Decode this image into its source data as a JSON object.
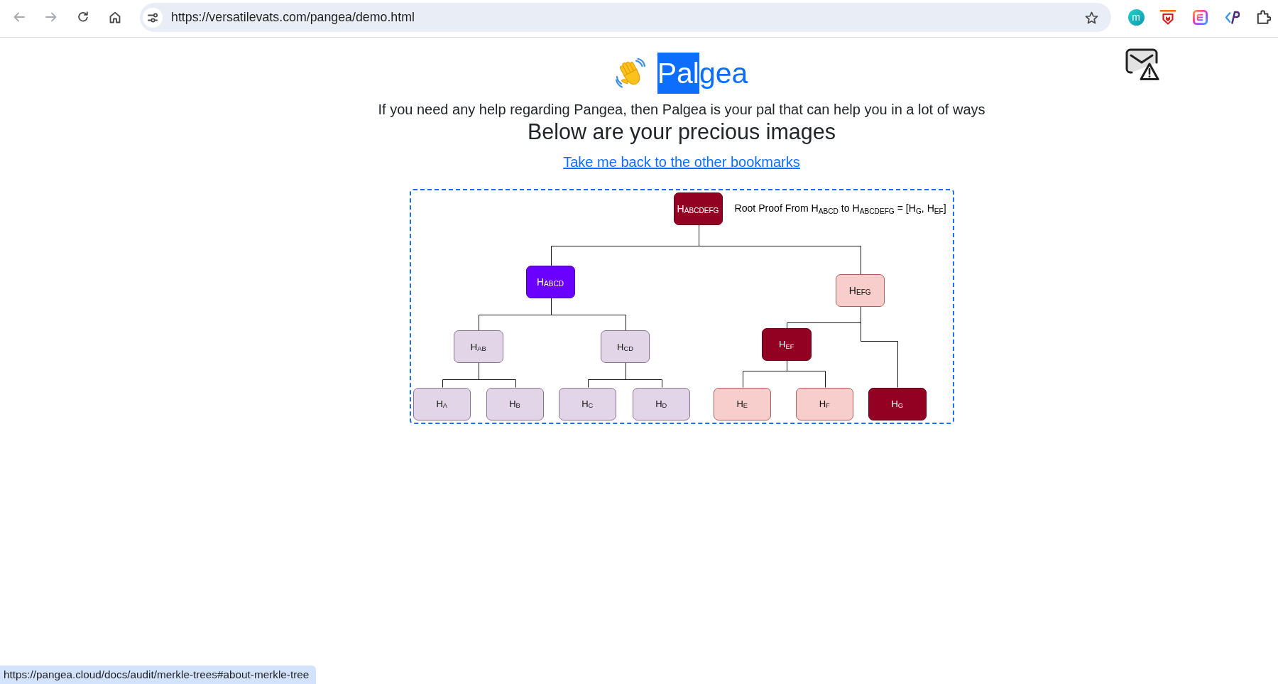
{
  "browser": {
    "back": {
      "disabled": true
    },
    "forward": {
      "disabled": true
    },
    "url": "https://versatilevats.com/pangea/demo.html",
    "extension_letter": "m"
  },
  "page": {
    "title_parts": [
      {
        "text": "Pal",
        "highlighted": true
      },
      {
        "text": "gea",
        "highlighted": false
      }
    ],
    "subtitle": "If you need any help regarding Pangea, then Palgea is your pal that can help you in a lot of ways",
    "heading": "Below are your precious images",
    "link": "Take me back to the other bookmarks",
    "diagram": {
      "annotation": "Root Proof From H$_{ABCD}$ to H$_{ABCDEFG}$ = [H$_{G}$, H$_{EF}$]",
      "tree": {
        "label": "H$_{ABCDEFG}$",
        "color": "#920022",
        "children": [
          {
            "label": "H$_{ABCD}$",
            "color": "#6a00ff",
            "children": [
              {
                "label": "H$_{AB}$",
                "color": "#e1d5e7",
                "children": [
                  {
                    "label": "H$_{A}$",
                    "color": "#e1d5e7"
                  },
                  {
                    "label": "H$_{B}$",
                    "color": "#e1d5e7"
                  }
                ]
              },
              {
                "label": "H$_{CD}$",
                "color": "#e1d5e7",
                "children": [
                  {
                    "label": "H$_{C}$",
                    "color": "#e1d5e7"
                  },
                  {
                    "label": "H$_{D}$",
                    "color": "#e1d5e7"
                  }
                ]
              }
            ]
          },
          {
            "label": "H$_{EFG}$",
            "color": "#f8cecc",
            "children": [
              {
                "label": "H$_{EF}$",
                "color": "#920022",
                "children": [
                  {
                    "label": "H$_{E}$",
                    "color": "#f8cecc"
                  },
                  {
                    "label": "H$_{F}$",
                    "color": "#f8cecc"
                  }
                ]
              },
              {
                "label": "H$_{G}$",
                "color": "#920022"
              }
            ]
          }
        ]
      }
    }
  },
  "status_url": "https://pangea.cloud/docs/audit/merkle-trees#about-merkle-tree"
}
